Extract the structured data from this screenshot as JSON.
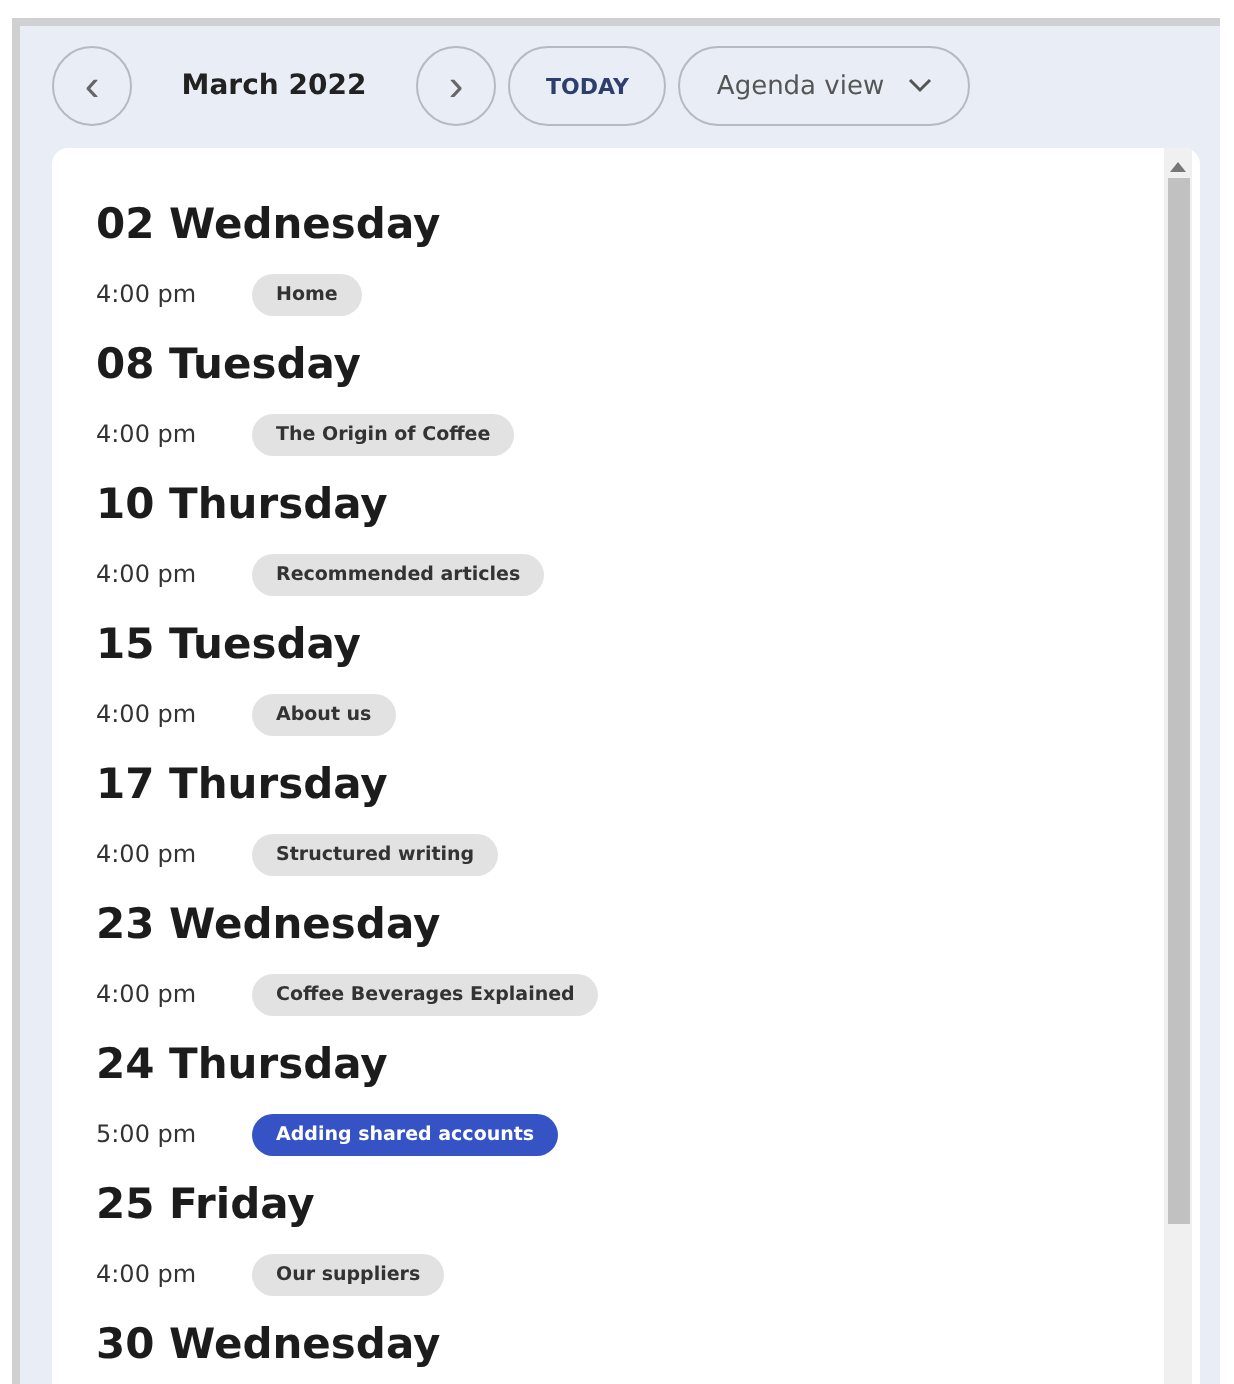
{
  "toolbar": {
    "prev": "‹",
    "month": "March 2022",
    "next": "›",
    "today": "TODAY",
    "view": "Agenda view"
  },
  "days": [
    {
      "heading": "02 Wednesday",
      "events": [
        {
          "time": "4:00 pm",
          "title": "Home",
          "selected": false
        }
      ]
    },
    {
      "heading": "08 Tuesday",
      "events": [
        {
          "time": "4:00 pm",
          "title": "The Origin of Coffee",
          "selected": false
        }
      ]
    },
    {
      "heading": "10 Thursday",
      "events": [
        {
          "time": "4:00 pm",
          "title": "Recommended articles",
          "selected": false
        }
      ]
    },
    {
      "heading": "15 Tuesday",
      "events": [
        {
          "time": "4:00 pm",
          "title": "About us",
          "selected": false
        }
      ]
    },
    {
      "heading": "17 Thursday",
      "events": [
        {
          "time": "4:00 pm",
          "title": "Structured writing",
          "selected": false
        }
      ]
    },
    {
      "heading": "23 Wednesday",
      "events": [
        {
          "time": "4:00 pm",
          "title": "Coffee Beverages Explained",
          "selected": false
        }
      ]
    },
    {
      "heading": "24 Thursday",
      "events": [
        {
          "time": "5:00 pm",
          "title": "Adding shared accounts",
          "selected": true
        }
      ]
    },
    {
      "heading": "25 Friday",
      "events": [
        {
          "time": "4:00 pm",
          "title": "Our suppliers",
          "selected": false
        }
      ]
    },
    {
      "heading": "30 Wednesday"
    }
  ]
}
